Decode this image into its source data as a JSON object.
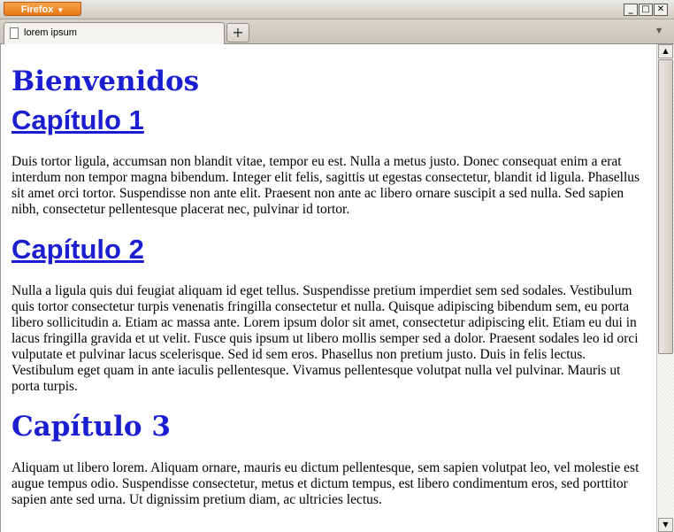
{
  "window": {
    "app_menu_label": "Firefox",
    "app_menu_arrow": "▼",
    "minimize_glyph": "_",
    "maximize_glyph": "□",
    "close_glyph": "✕"
  },
  "tabs": [
    {
      "label": "lorem ipsum",
      "icon": "page-icon"
    }
  ],
  "tabstrip": {
    "new_tab_glyph": "+",
    "list_tabs_glyph": "▼"
  },
  "page": {
    "title": "Bienvenidos",
    "chapters": [
      {
        "heading": "Capítulo 1",
        "body": "Duis tortor ligula, accumsan non blandit vitae, tempor eu est. Nulla a metus justo. Donec consequat enim a erat interdum non tempor magna bibendum. Integer elit felis, sagittis ut egestas consectetur, blandit id ligula. Phasellus sit amet orci tortor. Suspendisse non ante elit. Praesent non ante ac libero ornare suscipit a sed nulla. Sed sapien nibh, consectetur pellentesque placerat nec, pulvinar id tortor."
      },
      {
        "heading": "Capítulo 2",
        "body": "Nulla a ligula quis dui feugiat aliquam id eget tellus. Suspendisse pretium imperdiet sem sed sodales. Vestibulum quis tortor consectetur turpis venenatis fringilla consectetur et nulla. Quisque adipiscing bibendum sem, eu porta libero sollicitudin a. Etiam ac massa ante. Lorem ipsum dolor sit amet, consectetur adipiscing elit. Etiam eu dui in lacus fringilla gravida et ut velit. Fusce quis ipsum ut libero mollis semper sed a dolor. Praesent sodales leo id orci vulputate et pulvinar lacus scelerisque. Sed id sem eros. Phasellus non pretium justo. Duis in felis lectus. Vestibulum eget quam in ante iaculis pellentesque. Vivamus pellentesque volutpat nulla vel pulvinar. Mauris ut porta turpis."
      },
      {
        "heading": "Capítulo 3",
        "body": "Aliquam ut libero lorem. Aliquam ornare, mauris eu dictum pellentesque, sem sapien volutpat leo, vel molestie est augue tempus odio. Suspendisse consectetur, metus et dictum tempus, est libero condimentum eros, sed porttitor sapien ante sed urna. Ut dignissim pretium diam, ac ultricies lectus."
      }
    ]
  },
  "scrollbar": {
    "up_glyph": "▲",
    "down_glyph": "▼"
  }
}
